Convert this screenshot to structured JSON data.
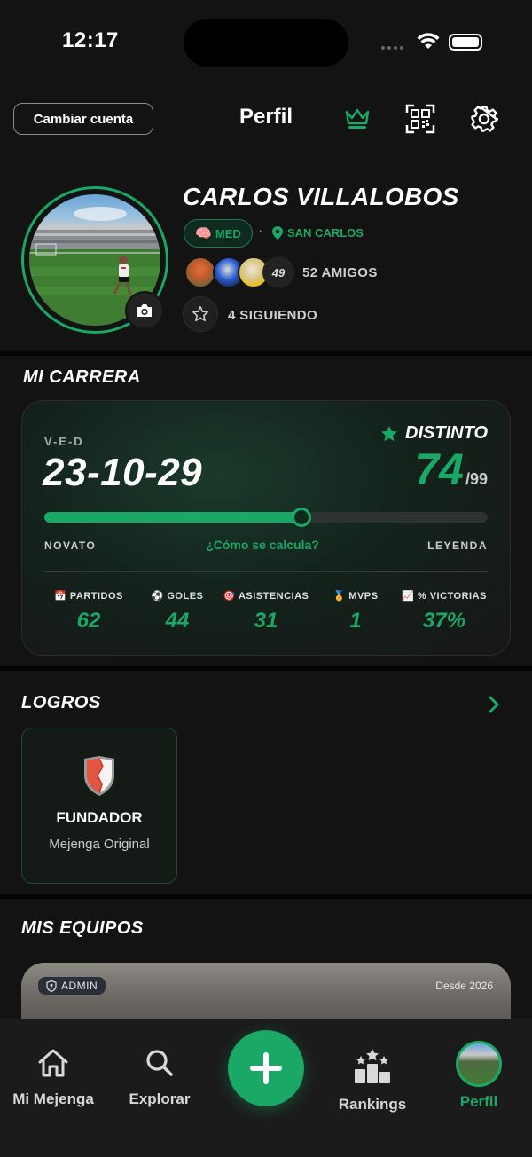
{
  "status_bar": {
    "time": "12:17"
  },
  "header": {
    "switch_account": "Cambiar cuenta",
    "title": "Perfil"
  },
  "profile": {
    "name": "CARLOS VILLALOBOS",
    "position": "MED",
    "separator": "·",
    "location": "SAN CARLOS",
    "friends_more": "49",
    "friends": "52 AMIGOS",
    "following": "4 SIGUIENDO"
  },
  "career": {
    "title": "MI CARRERA",
    "record_label": "V-E-D",
    "record": "23-10-29",
    "tier": "DISTINTO",
    "rating": "74",
    "rating_max": "/99",
    "progress": 0.58,
    "min_label": "NOVATO",
    "max_label": "LEYENDA",
    "how_link": "¿Cómo se calcula?",
    "stats": [
      {
        "icon": "calendar-icon",
        "label": "PARTIDOS",
        "value": "62"
      },
      {
        "icon": "soccer-ball-icon",
        "label": "GOLES",
        "value": "44"
      },
      {
        "icon": "target-icon",
        "label": "ASISTENCIAS",
        "value": "31"
      },
      {
        "icon": "medal-icon",
        "label": "MVPS",
        "value": "1"
      },
      {
        "icon": "chart-icon",
        "label": "% VICTORIAS",
        "value": "37%"
      }
    ]
  },
  "achievements": {
    "title": "LOGROS",
    "items": [
      {
        "icon": "shield-badge-icon",
        "title": "FUNDADOR",
        "subtitle": "Mejenga Original"
      }
    ]
  },
  "teams": {
    "title": "MIS EQUIPOS",
    "items": [
      {
        "badge": "ADMIN",
        "since": "Desde 2026"
      }
    ]
  },
  "tabbar": {
    "tabs": [
      {
        "icon": "home-icon",
        "label": "Mi Mejenga"
      },
      {
        "icon": "search-icon",
        "label": "Explorar"
      },
      {
        "icon": "plus-icon",
        "label": ""
      },
      {
        "icon": "ranking-icon",
        "label": "Rankings"
      },
      {
        "icon": "avatar",
        "label": "Perfil"
      }
    ],
    "active": "Perfil"
  },
  "colors": {
    "accent": "#19a866",
    "background": "#131313",
    "card": "#161616"
  }
}
